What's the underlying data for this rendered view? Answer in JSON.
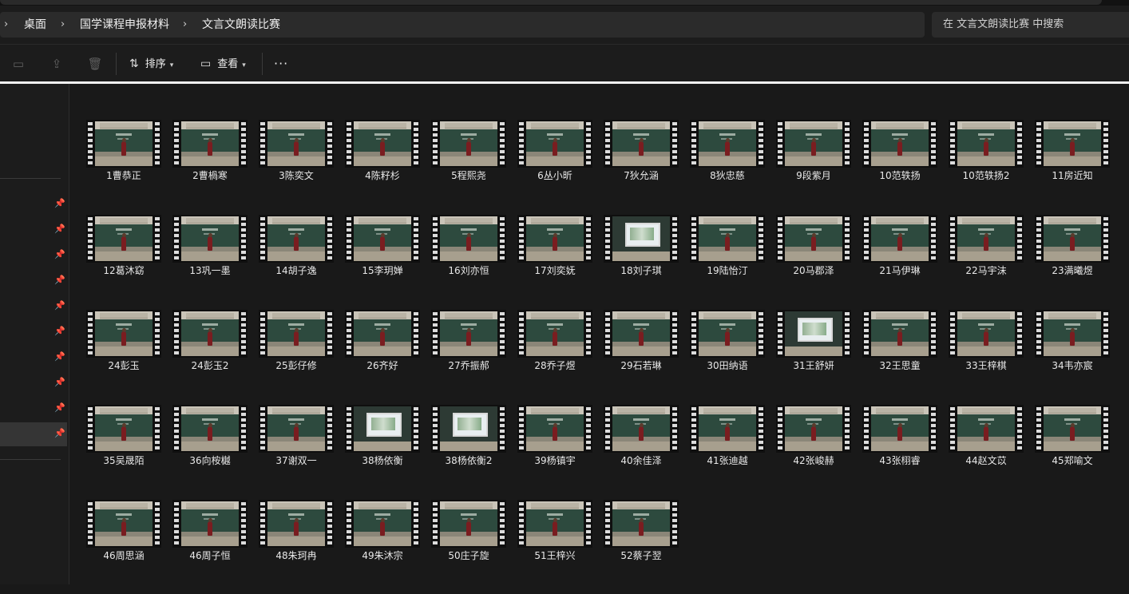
{
  "breadcrumb": {
    "items": [
      "桌面",
      "国学课程申报材料",
      "文言文朗读比赛"
    ]
  },
  "search": {
    "placeholder": "在 文言文朗读比赛 中搜索"
  },
  "toolbar": {
    "sort_label": "排序",
    "view_label": "查看",
    "more_label": "···"
  },
  "nav": {
    "pinned_count": 10,
    "selected_index": 9
  },
  "files": [
    "1曹恭正",
    "2曹楇寒",
    "3陈奕文",
    "4陈籽杉",
    "5程熙尧",
    "6丛小昕",
    "7狄允涵",
    "8狄忠慈",
    "9段紫月",
    "10范轶扬",
    "10范轶扬2",
    "11房近知",
    "12葛沐窈",
    "13巩一墨",
    "14胡子逸",
    "15李玥婵",
    "16刘亦恒",
    "17刘奕妩",
    "18刘子琪",
    "19陆怡汀",
    "20马郡泽",
    "21马伊琳",
    "22马宇沫",
    "23满曦煜",
    "24彭玉",
    "24彭玉2",
    "25彭仔修",
    "26齐好",
    "27乔振郝",
    "28乔子煜",
    "29石若琳",
    "30田纳语",
    "31王舒妍",
    "32王思童",
    "33王梓棋",
    "34韦亦宸",
    "35吴晟陌",
    "36向桉樾",
    "37谢双一",
    "38杨依衡",
    "38杨依衡2",
    "39杨镇宇",
    "40余佳泽",
    "41张迪越",
    "42张峻赫",
    "43张栩睿",
    "44赵文苡",
    "45郑喻文",
    "46周思涵",
    "46周子恒",
    "48朱珂冉",
    "49朱沐宗",
    "50庄子旋",
    "51王梓兴",
    "52蔡子翌"
  ]
}
